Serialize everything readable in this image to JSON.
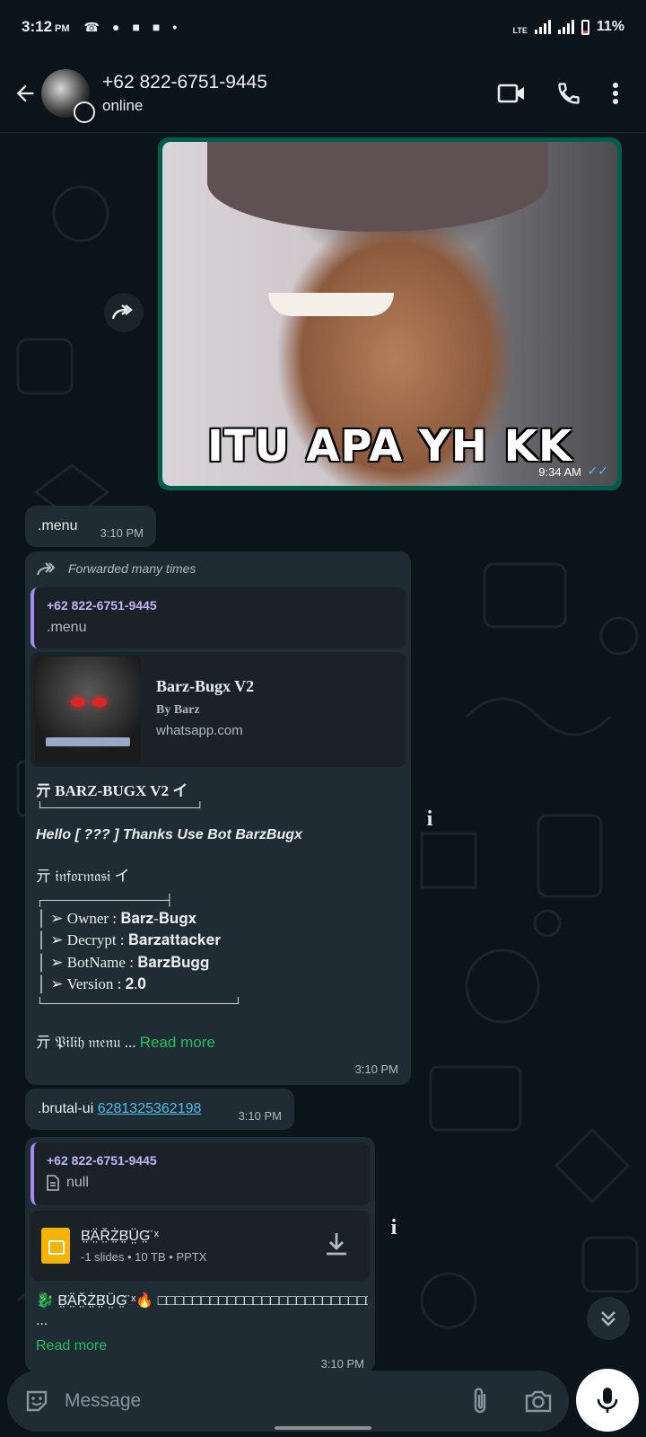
{
  "status_bar": {
    "time": "3:12",
    "ampm": "PM",
    "network": "LTE",
    "battery": "11%"
  },
  "header": {
    "contact_name": "+62 822-6751-9445",
    "status": "online"
  },
  "messages": {
    "image": {
      "caption": "ITU APA YH KK",
      "time": "9:34 AM"
    },
    "menu": {
      "text": ".menu",
      "time": "3:10 PM"
    },
    "bot_reply": {
      "forwarded_label": "Forwarded many times",
      "quote_name": "+62 822-6751-9445",
      "quote_text": ".menu",
      "link_title": "Barz-Bugx V2",
      "link_by": "By Barz",
      "link_domain": "whatsapp.com",
      "line1": "亓 BARZ-BUGX V2 イ",
      "line2": "└────────────────────┘",
      "line3": "Hello [ ??? ] Thanks Use Bot BarzBugx",
      "line4": "亓 𝔦𝔫𝔣𝔬𝔯𝔪𝔞𝔰𝔦 イ",
      "line5": "┌────────────────┤",
      "line6": "│ ➢ Owner : 𝐁𝐚𝐫𝐳-𝐁𝐮𝐠𝐱",
      "line7": "│ ➢ Decrypt : 𝐁𝐚𝐫𝐳𝐚𝐭𝐭𝐚𝐜𝐤𝐞𝐫",
      "line8": "│ ➢ BotName : 𝐁𝐚𝐫𝐳𝐁𝐮𝐠𝐠",
      "line9": "│ ➢ Version : 𝟐.𝟎",
      "line10": "└─────────────────────────┘",
      "line11": "亓 𝔓𝔦𝔩𝔦𝔥 𝔪𝔢𝔫𝔲 ...",
      "read_more": "Read more",
      "time": "3:10 PM"
    },
    "brutal": {
      "command": ".brutal-ui",
      "number": "6281325362198",
      "time": "3:10 PM"
    },
    "doc_reply": {
      "quote_name": "+62 822-6751-9445",
      "quote_text": "null",
      "file_name": "B̤̈Ä̤Ř̤Ż̤B̤̈Ṳ̈G̤̈ ˣ",
      "file_meta": "-1 slides • 10 TB • PPTX",
      "text": "🐉 B̤̈Ä̤Ř̤Ż̤B̤̈Ṳ̈G̤̈ ˣ🔥 □□□□□□□□□□□□□□□□□□□□□□□□□□□□□□□□",
      "ellipsis": "...",
      "read_more": "Read more",
      "time": "3:10 PM"
    }
  },
  "composer": {
    "placeholder": "Message"
  },
  "colors": {
    "background": "#0b141a",
    "outgoing_bubble": "#005c4b",
    "incoming_bubble": "#202c33",
    "accent_green": "#21c063",
    "link_blue": "#53bdeb",
    "quote_purple": "#a48aee"
  }
}
